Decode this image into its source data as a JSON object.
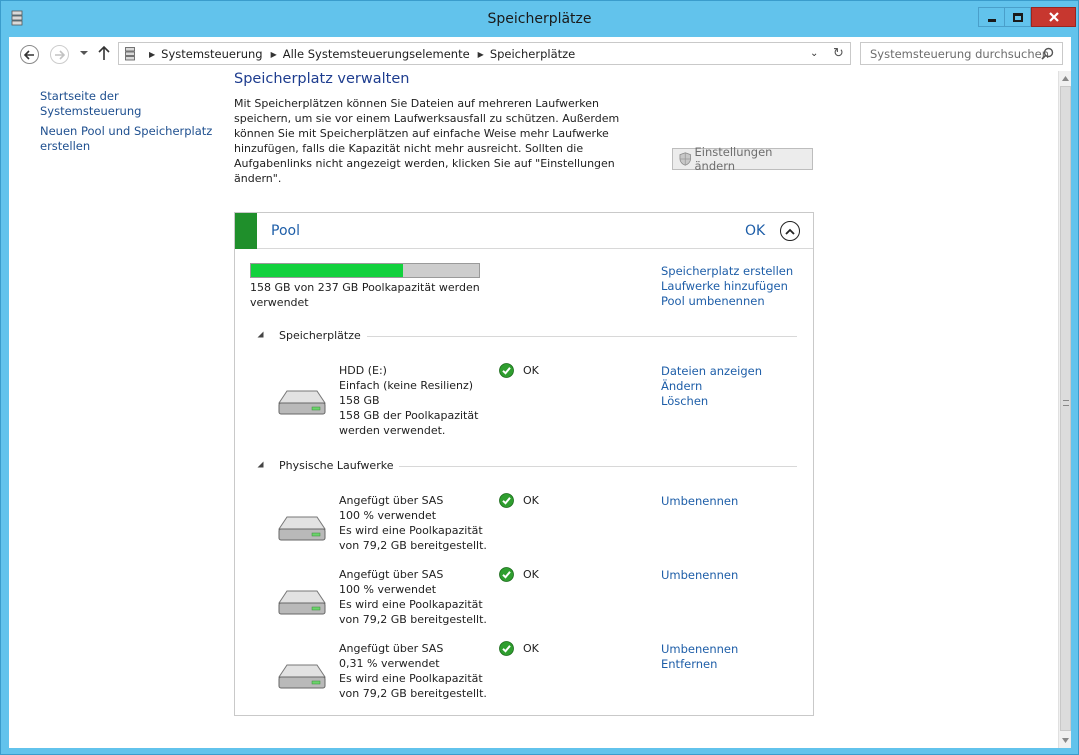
{
  "window": {
    "title": "Speicherplätze",
    "accent_color": "#62c3ec",
    "close_color": "#c7372f"
  },
  "navbar": {
    "breadcrumbs": [
      "Systemsteuerung",
      "Alle Systemsteuerungselemente",
      "Speicherplätze"
    ],
    "search_placeholder": "Systemsteuerung durchsuchen"
  },
  "sidebar": {
    "items": [
      {
        "label": "Startseite der Systemsteuerung"
      },
      {
        "label": "Neuen Pool und Speicherplatz erstellen"
      }
    ]
  },
  "main": {
    "title": "Speicherplatz verwalten",
    "description": "Mit Speicherplätzen können Sie Dateien auf mehreren Laufwerken speichern, um sie vor einem Laufwerksausfall zu schützen. Außerdem können Sie mit Speicherplätzen auf einfache Weise mehr Laufwerke hinzufügen, falls die Kapazität nicht mehr ausreicht. Sollten die Aufgabenlinks nicht angezeigt werden, klicken Sie auf \"Einstellungen ändern\".",
    "settings_button": "Einstellungen ändern"
  },
  "pool": {
    "name": "Pool",
    "status": "OK",
    "stripe_color": "#1f8f2b",
    "usage_fraction": 0.667,
    "capacity_text": "158 GB von 237 GB Poolkapazität werden verwendet",
    "links": [
      "Speicherplatz erstellen",
      "Laufwerke hinzufügen",
      "Pool umbenennen"
    ],
    "spaces_label": "Speicherplätze",
    "spaces": [
      {
        "lines": [
          "HDD (E:)",
          "Einfach (keine Resilienz)",
          "158 GB",
          "158 GB der Poolkapazität",
          "werden verwendet."
        ],
        "status": "OK",
        "links": [
          "Dateien anzeigen",
          "Ändern",
          "Löschen"
        ]
      }
    ],
    "drives_label": "Physische Laufwerke",
    "drives": [
      {
        "lines": [
          "Angefügt über SAS",
          "100 % verwendet",
          "Es wird eine Poolkapazität",
          "von 79,2 GB bereitgestellt."
        ],
        "status": "OK",
        "links": [
          "Umbenennen"
        ]
      },
      {
        "lines": [
          "Angefügt über SAS",
          "100 % verwendet",
          "Es wird eine Poolkapazität",
          "von 79,2 GB bereitgestellt."
        ],
        "status": "OK",
        "links": [
          "Umbenennen"
        ]
      },
      {
        "lines": [
          "Angefügt über SAS",
          "0,31 % verwendet",
          "Es wird eine Poolkapazität",
          "von 79,2 GB bereitgestellt."
        ],
        "status": "OK",
        "links": [
          "Umbenennen",
          "Entfernen"
        ]
      }
    ]
  }
}
